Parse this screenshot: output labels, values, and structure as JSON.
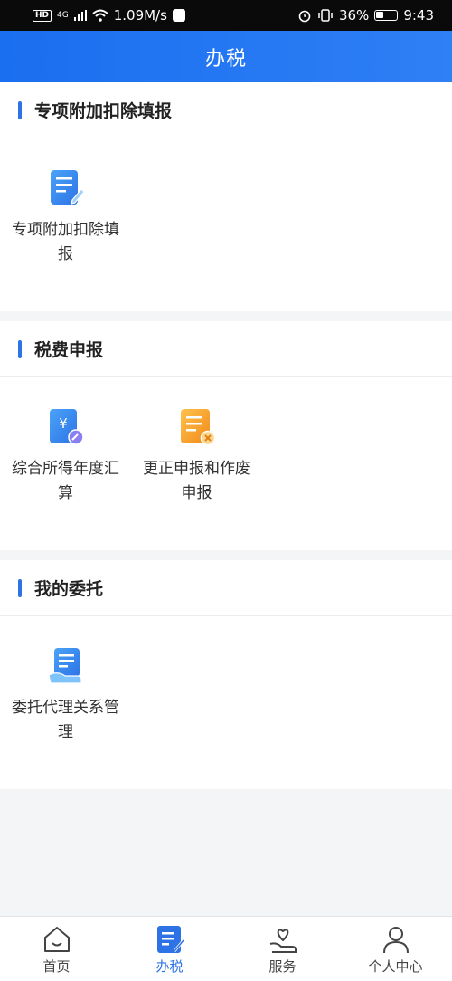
{
  "status_bar": {
    "hd": "HD",
    "signal": "4G",
    "speed": "1.09M/s",
    "battery_pct": "36%",
    "battery_level": 0.36,
    "time": "9:43"
  },
  "header": {
    "title": "办税"
  },
  "sections": [
    {
      "title": "专项附加扣除填报",
      "items": [
        {
          "label": "专项附加扣除填报",
          "icon": "form-edit-icon"
        }
      ]
    },
    {
      "title": "税费申报",
      "items": [
        {
          "label": "综合所得年度汇算",
          "icon": "yuan-document-icon"
        },
        {
          "label": "更正申报和作废申报",
          "icon": "document-cancel-icon"
        }
      ]
    },
    {
      "title": "我的委托",
      "items": [
        {
          "label": "委托代理关系管理",
          "icon": "document-hand-icon"
        }
      ]
    }
  ],
  "bottom_nav": [
    {
      "label": "首页",
      "icon": "home-icon"
    },
    {
      "label": "办税",
      "icon": "tax-document-icon",
      "active": true
    },
    {
      "label": "服务",
      "icon": "heart-hand-icon"
    },
    {
      "label": "个人中心",
      "icon": "person-icon"
    }
  ],
  "colors": {
    "accent": "#2d73e6",
    "header_start": "#1a6ff0",
    "header_end": "#2f7ff5",
    "page_bg": "#f4f5f7",
    "orange": "#f5a524"
  }
}
